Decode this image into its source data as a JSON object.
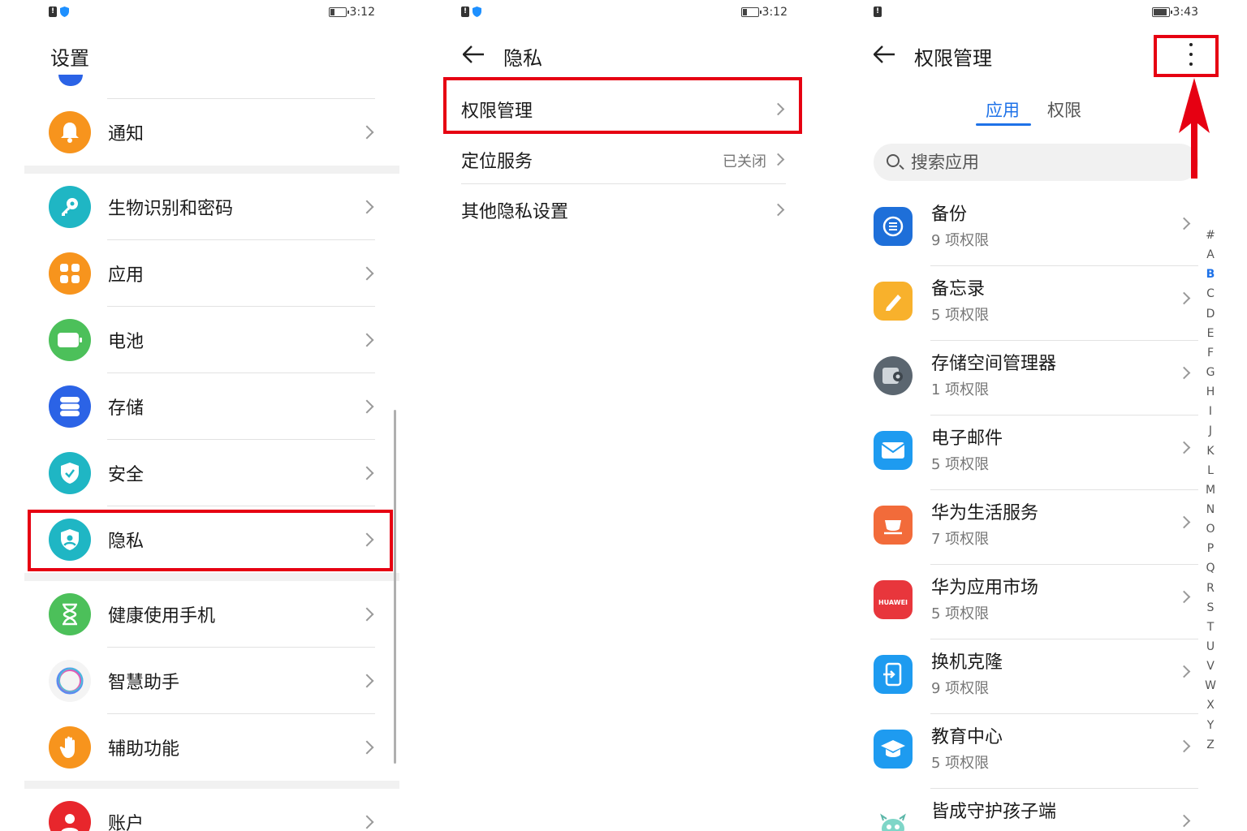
{
  "panel1": {
    "status": {
      "time": "3:12"
    },
    "title": "设置",
    "items": [
      {
        "label": "通知",
        "icon": "bell-icon",
        "color": "#f7941d"
      },
      {
        "label": "生物识别和密码",
        "icon": "key-icon",
        "color": "#1fb6c4"
      },
      {
        "label": "应用",
        "icon": "apps-grid-icon",
        "color": "#f7941d"
      },
      {
        "label": "电池",
        "icon": "battery-icon",
        "color": "#4cc05a"
      },
      {
        "label": "存储",
        "icon": "storage-icon",
        "color": "#2b63e6"
      },
      {
        "label": "安全",
        "icon": "shield-check-icon",
        "color": "#1fb6c4"
      },
      {
        "label": "隐私",
        "icon": "privacy-shield-icon",
        "color": "#1fb6c4"
      },
      {
        "label": "健康使用手机",
        "icon": "hourglass-icon",
        "color": "#4cc05a"
      },
      {
        "label": "智慧助手",
        "icon": "assistant-ring-icon",
        "color": "#ffffff"
      },
      {
        "label": "辅助功能",
        "icon": "hand-icon",
        "color": "#f7941d"
      },
      {
        "label": "账户",
        "icon": "account-icon",
        "color": "#e8262c"
      }
    ]
  },
  "panel2": {
    "status": {
      "time": "3:12"
    },
    "title": "隐私",
    "items": [
      {
        "label": "权限管理",
        "value": ""
      },
      {
        "label": "定位服务",
        "value": "已关闭"
      },
      {
        "label": "其他隐私设置",
        "value": ""
      }
    ]
  },
  "panel3": {
    "status": {
      "time": "3:43"
    },
    "title": "权限管理",
    "tabs": [
      "应用",
      "权限"
    ],
    "search_placeholder": "搜索应用",
    "apps": [
      {
        "name": "备份",
        "count": "9 项权限",
        "color": "#1e6fd9"
      },
      {
        "name": "备忘录",
        "count": "5 项权限",
        "color": "#f8b12c"
      },
      {
        "name": "存储空间管理器",
        "count": "1 项权限",
        "color": "#5b6670"
      },
      {
        "name": "电子邮件",
        "count": "5 项权限",
        "color": "#1e9bf0"
      },
      {
        "name": "华为生活服务",
        "count": "7 项权限",
        "color": "#f26b3a"
      },
      {
        "name": "华为应用市场",
        "count": "5 项权限",
        "color": "#e8363c",
        "badge": "HUAWEI"
      },
      {
        "name": "换机克隆",
        "count": "9 项权限",
        "color": "#1e9bf0"
      },
      {
        "name": "教育中心",
        "count": "5 项权限",
        "color": "#1e9bf0"
      },
      {
        "name": "皆成守护孩子端",
        "count": "",
        "color": "#ffffff"
      }
    ],
    "alphabet": [
      "#",
      "A",
      "B",
      "C",
      "D",
      "E",
      "F",
      "G",
      "H",
      "I",
      "J",
      "K",
      "L",
      "M",
      "N",
      "O",
      "P",
      "Q",
      "R",
      "S",
      "T",
      "U",
      "V",
      "W",
      "X",
      "Y",
      "Z"
    ],
    "alphabet_active": "B"
  },
  "highlight_color": "#e60012",
  "accent_color": "#1e72e8"
}
